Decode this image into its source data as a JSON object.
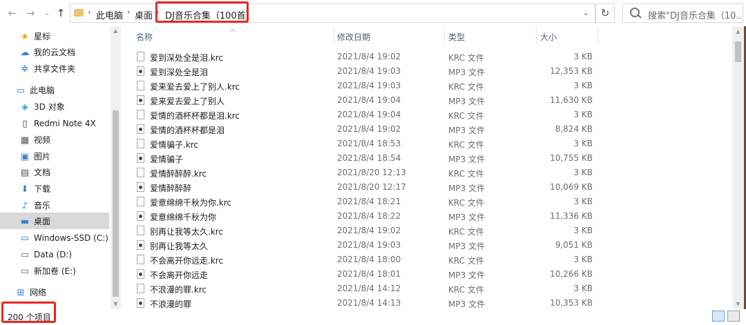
{
  "nav": {
    "back_icon": "←",
    "forward_icon": "→",
    "recent_icon": "⌄",
    "up_icon": "↑"
  },
  "address": {
    "crumbs": [
      "此电脑",
      "桌面",
      "DJ音乐合集（100首）"
    ],
    "separator": "›",
    "dropdown_icon": "⌄"
  },
  "refresh_icon": "↻",
  "search": {
    "placeholder": "搜索\"DJ音乐合集（10..."
  },
  "sidebar": {
    "items": [
      {
        "label": "星标",
        "icon": "★",
        "color": "#e8a317"
      },
      {
        "label": "我的云文档",
        "icon": "☁",
        "color": "#2f7fd8"
      },
      {
        "label": "共享文件夹",
        "icon": "✲",
        "color": "#2f7fd8"
      },
      {
        "label": "此电脑",
        "icon": "▭",
        "color": "#2f7fd8"
      },
      {
        "label": "3D 对象",
        "icon": "◈",
        "color": "#29a3d8"
      },
      {
        "label": "Redmi Note 4X",
        "icon": "▯",
        "color": "#333333"
      },
      {
        "label": "视频",
        "icon": "▦",
        "color": "#555555"
      },
      {
        "label": "图片",
        "icon": "▣",
        "color": "#3a7fc4"
      },
      {
        "label": "文档",
        "icon": "▤",
        "color": "#555555"
      },
      {
        "label": "下载",
        "icon": "⬇",
        "color": "#2f7fd8"
      },
      {
        "label": "音乐",
        "icon": "♪",
        "color": "#2f7fd8"
      },
      {
        "label": "桌面",
        "icon": "▬",
        "color": "#2f7fd8"
      },
      {
        "label": "Windows-SSD (C:)",
        "icon": "▭",
        "color": "#2f7fd8"
      },
      {
        "label": "Data (D:)",
        "icon": "▭",
        "color": "#666666"
      },
      {
        "label": "新加卷 (E:)",
        "icon": "▭",
        "color": "#666666"
      },
      {
        "label": "网络",
        "icon": "⊞",
        "color": "#2f7fd8"
      }
    ]
  },
  "columns": {
    "name": "名称",
    "date": "修改日期",
    "type": "类型",
    "size": "大小"
  },
  "files": [
    {
      "name": "爱到深处全是泪.krc",
      "date": "2021/8/4 19:02",
      "type": "KRC 文件",
      "size": "3 KB",
      "kind": "krc"
    },
    {
      "name": "爱到深处全是泪",
      "date": "2021/8/4 19:03",
      "type": "MP3 文件",
      "size": "12,353 KB",
      "kind": "mp3"
    },
    {
      "name": "爱来爱去爱上了别人.krc",
      "date": "2021/8/4 19:03",
      "type": "KRC 文件",
      "size": "3 KB",
      "kind": "krc"
    },
    {
      "name": "爱来爱去爱上了别人",
      "date": "2021/8/4 19:04",
      "type": "MP3 文件",
      "size": "11,630 KB",
      "kind": "mp3"
    },
    {
      "name": "爱情的酒杯杯都是泪.krc",
      "date": "2021/8/4 19:04",
      "type": "KRC 文件",
      "size": "3 KB",
      "kind": "krc"
    },
    {
      "name": "爱情的酒杯杯都是泪",
      "date": "2021/8/4 19:02",
      "type": "MP3 文件",
      "size": "8,824 KB",
      "kind": "mp3"
    },
    {
      "name": "爱情骗子.krc",
      "date": "2021/8/4 18:53",
      "type": "KRC 文件",
      "size": "3 KB",
      "kind": "krc"
    },
    {
      "name": "爱情骗子",
      "date": "2021/8/4 18:54",
      "type": "MP3 文件",
      "size": "10,755 KB",
      "kind": "mp3"
    },
    {
      "name": "爱情醉醉醉.krc",
      "date": "2021/8/20 12:13",
      "type": "KRC 文件",
      "size": "3 KB",
      "kind": "krc"
    },
    {
      "name": "爱情醉醉醉",
      "date": "2021/8/20 12:17",
      "type": "MP3 文件",
      "size": "10,069 KB",
      "kind": "mp3"
    },
    {
      "name": "爱意绵绵千秋为你.krc",
      "date": "2021/8/4 18:21",
      "type": "KRC 文件",
      "size": "3 KB",
      "kind": "krc"
    },
    {
      "name": "爱意绵绵千秋为你",
      "date": "2021/8/4 18:22",
      "type": "MP3 文件",
      "size": "11,336 KB",
      "kind": "mp3"
    },
    {
      "name": "别再让我等太久.krc",
      "date": "2021/8/4 19:02",
      "type": "KRC 文件",
      "size": "3 KB",
      "kind": "krc"
    },
    {
      "name": "别再让我等太久",
      "date": "2021/8/4 19:03",
      "type": "MP3 文件",
      "size": "9,051 KB",
      "kind": "mp3"
    },
    {
      "name": "不会离开你远走.krc",
      "date": "2021/8/4 18:00",
      "type": "KRC 文件",
      "size": "3 KB",
      "kind": "krc"
    },
    {
      "name": "不会离开你远走",
      "date": "2021/8/4 18:01",
      "type": "MP3 文件",
      "size": "10,266 KB",
      "kind": "mp3"
    },
    {
      "name": "不浪漫的罪.krc",
      "date": "2021/8/4 14:12",
      "type": "KRC 文件",
      "size": "3 KB",
      "kind": "krc"
    },
    {
      "name": "不浪漫的罪",
      "date": "2021/8/4 14:13",
      "type": "MP3 文件",
      "size": "10,353 KB",
      "kind": "mp3"
    }
  ],
  "status": {
    "count": "200 个项目"
  },
  "colors": {
    "highlight": "#e8261f",
    "header_text": "#4c607a",
    "selected_bg": "#d9d9d9"
  }
}
